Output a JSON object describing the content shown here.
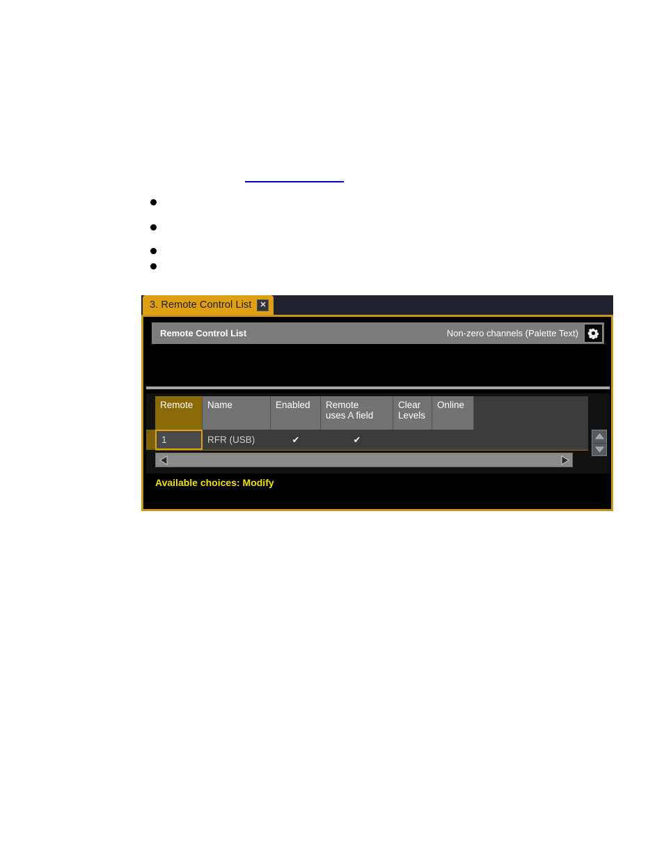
{
  "document": {
    "link_rule": "",
    "bullets": [
      "",
      "",
      "",
      ""
    ]
  },
  "dialog": {
    "tab": {
      "title": "3. Remote Control List",
      "close_label": "✕",
      "close_icon": "close-icon"
    },
    "panel": {
      "title": "Remote Control List",
      "subtitle": "Non-zero channels (Palette Text)",
      "gear_icon": "gear-icon"
    },
    "table": {
      "columns": [
        {
          "label": "Remote",
          "selected": true
        },
        {
          "label": "Name",
          "selected": false
        },
        {
          "label": "Enabled",
          "selected": false
        },
        {
          "label": "Remote\nuses A field",
          "selected": false
        },
        {
          "label": "Clear\nLevels",
          "selected": false
        },
        {
          "label": "Online",
          "selected": false
        }
      ],
      "rows": [
        {
          "remote": "1",
          "name": "RFR (USB)",
          "enabled": "✔",
          "remote_uses_a_field": "✔",
          "clear_levels": "",
          "online": ""
        }
      ]
    },
    "scrollbars": {
      "vertical_up_icon": "triangle-up-icon",
      "vertical_down_icon": "triangle-down-icon",
      "horizontal_left_icon": "triangle-left-icon",
      "horizontal_right_icon": "triangle-right-icon"
    },
    "footer": {
      "status": "Available choices: Modify"
    }
  },
  "colors": {
    "accent_gold": "#e0a013",
    "border_gold": "#c8951a",
    "status_yellow": "#f2e206",
    "panel_gray": "#7c7c7c",
    "header_cell_gray": "#737373",
    "selected_column": "#8a6a07",
    "row_gray": "#3b3b3b",
    "link_blue": "#0000cc"
  }
}
